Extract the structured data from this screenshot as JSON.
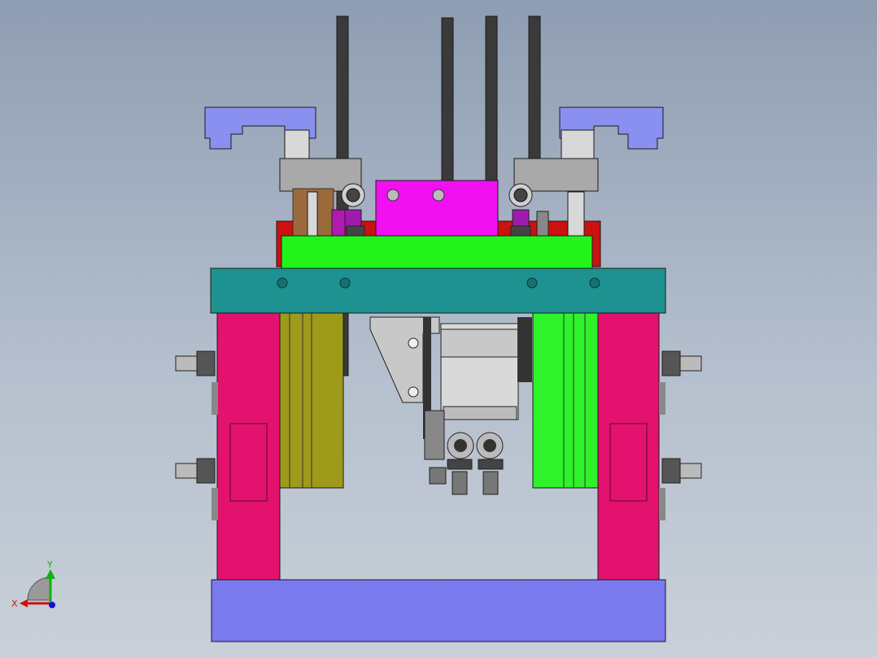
{
  "viewport": {
    "background": "gradient-grey-blue"
  },
  "model": {
    "colors": {
      "base_plate": "#7a7aee",
      "pillar": "#e3126e",
      "cross_plate": "#1e9290",
      "top_plate": "#22f41b",
      "red_block": "#cc1111",
      "magenta_block": "#f010f0",
      "olive_cylinder": "#9e9a1a",
      "green_cylinder": "#2ef22a",
      "clamp": "#8a90f0",
      "rod": "#3a3a3a",
      "steel": "#a9a9a9",
      "steel_light": "#d8d8d8"
    }
  },
  "triad": {
    "x_label": "X",
    "y_label": "Y",
    "x_color": "#d01010",
    "y_color": "#10b010",
    "z_color": "#1010d0"
  }
}
